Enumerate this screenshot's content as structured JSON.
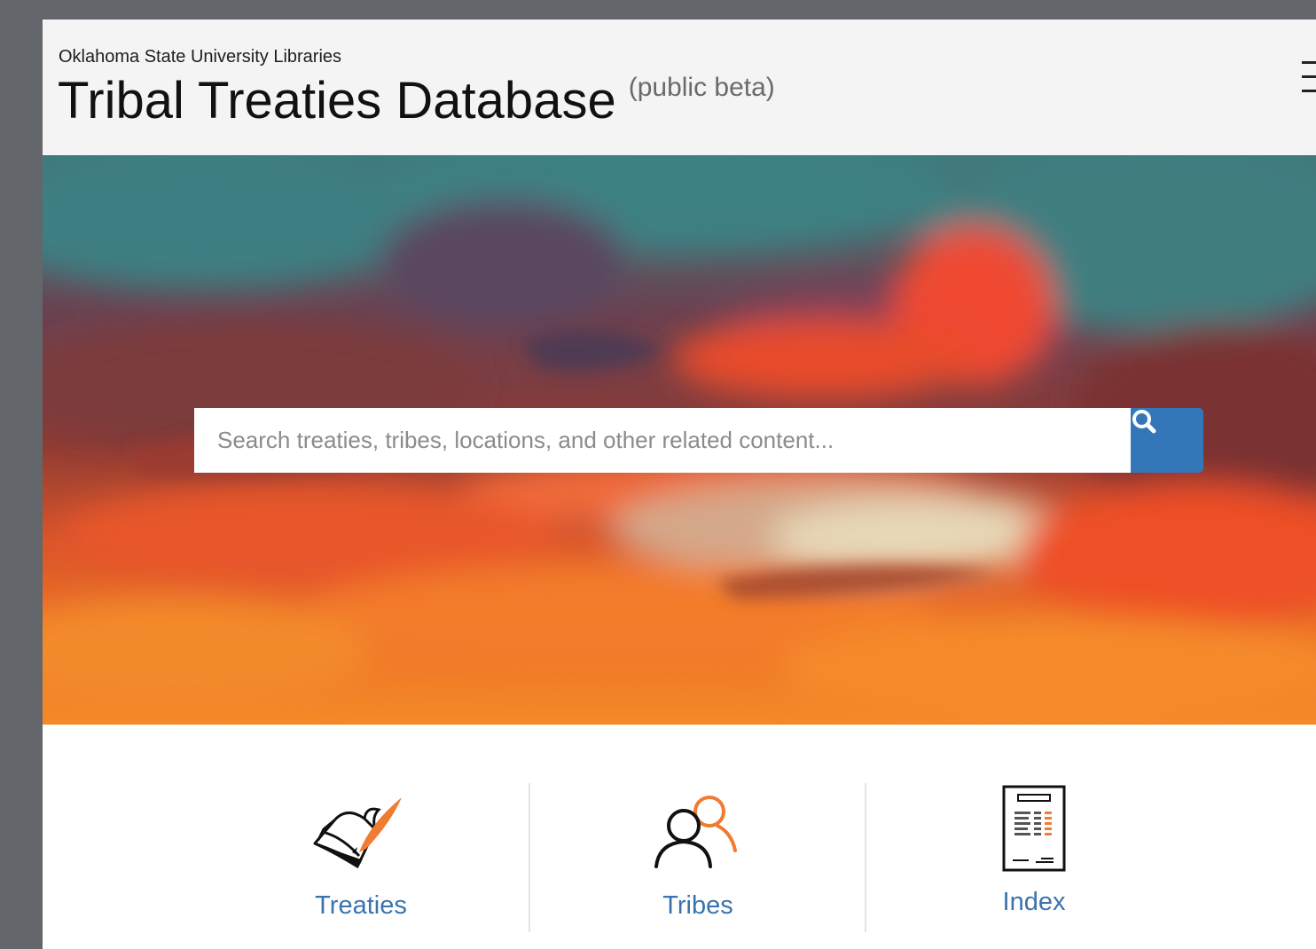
{
  "header": {
    "org": "Oklahoma State University Libraries",
    "title": "Tribal Treaties Database",
    "badge": "(public beta)"
  },
  "search": {
    "placeholder": "Search treaties, tribes, locations, and other related content...",
    "value": ""
  },
  "cards": [
    {
      "label": "Treaties",
      "icon": "treaty-document-quill-icon"
    },
    {
      "label": "Tribes",
      "icon": "people-group-icon"
    },
    {
      "label": "Index",
      "icon": "index-document-icon"
    }
  ],
  "colors": {
    "accent": "#3477b9",
    "link": "#3a73ad",
    "orange": "#f07b32",
    "header_bg": "#f4f4f4"
  }
}
